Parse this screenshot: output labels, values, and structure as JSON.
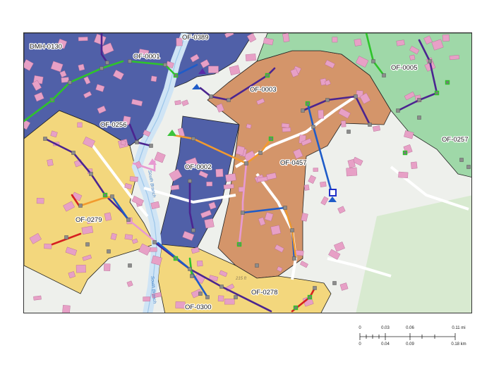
{
  "map": {
    "labels": {
      "dmh0130": "DMH-0130",
      "of0389": "OF-0389",
      "of0001": "OF-0001",
      "of0005": "OF-0005",
      "of0003": "OF-0003",
      "of0256": "OF-0256",
      "of0257": "OF-0257",
      "of0002": "OF-0002",
      "of0457": "OF-0457",
      "of0279": "OF-0279",
      "of0278": "OF-0278",
      "of0300": "OF-0300"
    },
    "river_label_1": "South Branch",
    "river_label_2": "South Branch",
    "street_label": "215 ft",
    "colors": {
      "catchment_blue": "#5060a8",
      "catchment_orange": "#d4956a",
      "catchment_yellow": "#f3d77d",
      "catchment_green": "#9fd8a8",
      "building": "#e7a0c6",
      "pipe_purple": "#4b2590",
      "pipe_green": "#2ec42a",
      "pipe_orange": "#f29a2e",
      "pipe_blue": "#1f5cc8",
      "pipe_pink": "#e79ad2",
      "pipe_red": "#d62020",
      "structure_gray": "#8c8c8c"
    }
  },
  "scale_bar": {
    "mi_ticks": [
      "0",
      "0.03",
      "0.06",
      "0.11 mi"
    ],
    "km_ticks": [
      "0",
      "0.04",
      "0.09",
      "0.18 km"
    ]
  }
}
